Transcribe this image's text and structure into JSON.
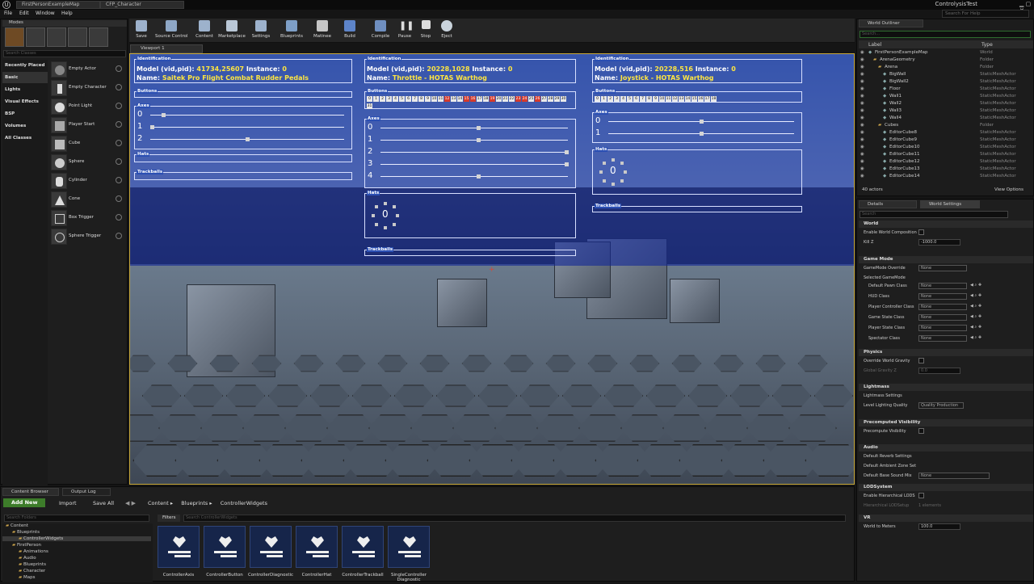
{
  "window": {
    "tabs": [
      "FirstPersonExampleMap",
      "CFP_Character"
    ],
    "project": "ControlysisTest",
    "help_placeholder": "Search For Help"
  },
  "menu": [
    "File",
    "Edit",
    "Window",
    "Help"
  ],
  "modes": {
    "title": "Modes",
    "search_placeholder": "Search Classes",
    "categories": [
      "Recently Placed",
      "Basic",
      "Lights",
      "Visual Effects",
      "BSP",
      "Volumes",
      "All Classes"
    ],
    "items": [
      "Empty Actor",
      "Empty Character",
      "Point Light",
      "Player Start",
      "Cube",
      "Sphere",
      "Cylinder",
      "Cone",
      "Box Trigger",
      "Sphere Trigger"
    ]
  },
  "toolbar": [
    "Save",
    "Source Control",
    "Content",
    "Marketplace",
    "Settings",
    "Blueprints",
    "Matinee",
    "Build",
    "Compile",
    "Pause",
    "Stop",
    "Eject"
  ],
  "viewport": {
    "tab": "Viewport 1",
    "panels": [
      {
        "model_label": "Model (vid,pid):",
        "model": "41734,25607",
        "instance_label": "Instance:",
        "instance": "0",
        "name_label": "Name:",
        "name": "Saitek Pro Flight Combat Rudder Pedals",
        "buttons": [],
        "axes": [
          {
            "label": "0",
            "value": 0.06
          },
          {
            "label": "1",
            "value": 0.0
          },
          {
            "label": "2",
            "value": 0.5
          }
        ],
        "hat": null
      },
      {
        "model_label": "Model (vid,pid):",
        "model": "20228,1028",
        "instance_label": "Instance:",
        "instance": "0",
        "name_label": "Name:",
        "name": "Throttle - HOTAS Warthog",
        "buttons": [
          "0",
          "1",
          "2",
          "3",
          "4",
          "5",
          "6",
          "7",
          "8",
          "9",
          "10",
          "11",
          "12",
          "13",
          "14",
          "15",
          "16",
          "17",
          "18",
          "19",
          "20",
          "21",
          "22",
          "23",
          "24",
          "25",
          "26",
          "27",
          "28",
          "29",
          "30",
          "31"
        ],
        "buttons_on": [
          "12",
          "15",
          "16",
          "19",
          "23",
          "24",
          "26"
        ],
        "axes": [
          {
            "label": "0",
            "value": 0.52
          },
          {
            "label": "1",
            "value": 0.52
          },
          {
            "label": "2",
            "value": 1.0
          },
          {
            "label": "3",
            "value": 1.0
          },
          {
            "label": "4",
            "value": 0.52
          }
        ],
        "hat": "0"
      },
      {
        "model_label": "Model (vid,pid):",
        "model": "20228,516",
        "instance_label": "Instance:",
        "instance": "0",
        "name_label": "Name:",
        "name": "Joystick - HOTAS Warthog",
        "buttons": [
          "0",
          "1",
          "2",
          "3",
          "4",
          "5",
          "6",
          "7",
          "8",
          "9",
          "10",
          "11",
          "12",
          "13",
          "14",
          "15",
          "16",
          "17",
          "18"
        ],
        "buttons_on": [],
        "axes": [
          {
            "label": "0",
            "value": 0.5
          },
          {
            "label": "1",
            "value": 0.5
          }
        ],
        "hat": "0"
      }
    ],
    "sections": {
      "id": "Identification",
      "buttons": "Buttons",
      "axes": "Axes",
      "hats": "Hats",
      "trackballs": "Trackballs"
    }
  },
  "outliner": {
    "title": "World Outliner",
    "search_placeholder": "Search...",
    "col_label": "Label",
    "col_type": "Type",
    "rows": [
      {
        "label": "FirstPersonExampleMap",
        "type": "World",
        "indent": 0
      },
      {
        "label": "ArenaGeometry",
        "type": "Folder",
        "indent": 1
      },
      {
        "label": "Arena",
        "type": "Folder",
        "indent": 2
      },
      {
        "label": "BigWall",
        "type": "StaticMeshActor",
        "indent": 3
      },
      {
        "label": "BigWall2",
        "type": "StaticMeshActor",
        "indent": 3
      },
      {
        "label": "Floor",
        "type": "StaticMeshActor",
        "indent": 3
      },
      {
        "label": "Wall1",
        "type": "StaticMeshActor",
        "indent": 3
      },
      {
        "label": "Wall2",
        "type": "StaticMeshActor",
        "indent": 3
      },
      {
        "label": "Wall3",
        "type": "StaticMeshActor",
        "indent": 3
      },
      {
        "label": "Wall4",
        "type": "StaticMeshActor",
        "indent": 3
      },
      {
        "label": "Cubes",
        "type": "Folder",
        "indent": 2
      },
      {
        "label": "EditorCube8",
        "type": "StaticMeshActor",
        "indent": 3
      },
      {
        "label": "EditorCube9",
        "type": "StaticMeshActor",
        "indent": 3
      },
      {
        "label": "EditorCube10",
        "type": "StaticMeshActor",
        "indent": 3
      },
      {
        "label": "EditorCube11",
        "type": "StaticMeshActor",
        "indent": 3
      },
      {
        "label": "EditorCube12",
        "type": "StaticMeshActor",
        "indent": 3
      },
      {
        "label": "EditorCube13",
        "type": "StaticMeshActor",
        "indent": 3
      },
      {
        "label": "EditorCube14",
        "type": "StaticMeshActor",
        "indent": 3
      }
    ],
    "count": "40 actors",
    "view_options": "View Options"
  },
  "details": {
    "tabs": [
      "Details",
      "World Settings"
    ],
    "search_placeholder": "Search",
    "world": {
      "hdr": "World",
      "enable_comp": "Enable World Composition",
      "killz_label": "Kill Z",
      "killz": "-1000.0"
    },
    "gamemode": {
      "hdr": "Game Mode",
      "override_label": "GameMode Override",
      "override": "None",
      "selected": "Selected GameMode",
      "classes": [
        {
          "label": "Default Pawn Class",
          "value": "None"
        },
        {
          "label": "HUD Class",
          "value": "None"
        },
        {
          "label": "Player Controller Class",
          "value": "None"
        },
        {
          "label": "Game State Class",
          "value": "None"
        },
        {
          "label": "Player State Class",
          "value": "None"
        },
        {
          "label": "Spectator Class",
          "value": "None"
        }
      ]
    },
    "physics": {
      "hdr": "Physics",
      "override": "Override World Gravity",
      "gravity_label": "Global Gravity Z",
      "gravity": "0.0"
    },
    "lightmass": {
      "hdr": "Lightmass",
      "settings": "Lightmass Settings",
      "quality_label": "Level Lighting Quality",
      "quality": "Quality Production"
    },
    "precomputed": {
      "hdr": "Precomputed Visibility",
      "label": "Precompute Visibility"
    },
    "audio": {
      "hdr": "Audio",
      "reverb": "Default Reverb Settings",
      "ambient": "Default Ambient Zone Set",
      "mix_label": "Default Base Sound Mix",
      "mix": "None"
    },
    "lod": {
      "hdr": "LODSystem",
      "enable": "Enable Hierarchical LODS",
      "setup_label": "Hierarchical LODSetup",
      "setup": "1 elements"
    },
    "vr": {
      "hdr": "VR",
      "meters_label": "World to Meters",
      "meters": "100.0"
    }
  },
  "content_browser": {
    "tabs": [
      "Content Browser",
      "Output Log"
    ],
    "add_new": "Add New",
    "import": "Import",
    "save_all": "Save All",
    "path": [
      "Content",
      "Blueprints",
      "ControllerWidgets"
    ],
    "search_folders": "Search Folders",
    "filters": "Filters",
    "search_assets": "Search ControllerWidgets",
    "tree": [
      {
        "label": "Content",
        "indent": 0
      },
      {
        "label": "Blueprints",
        "indent": 1
      },
      {
        "label": "ControllerWidgets",
        "indent": 2,
        "sel": true
      },
      {
        "label": "FirstPerson",
        "indent": 1
      },
      {
        "label": "Animations",
        "indent": 2
      },
      {
        "label": "Audio",
        "indent": 2
      },
      {
        "label": "Blueprints",
        "indent": 2
      },
      {
        "label": "Character",
        "indent": 2
      },
      {
        "label": "Maps",
        "indent": 2
      }
    ],
    "assets": [
      "ControllerAxis",
      "ControllerButton",
      "ControllerDiagnostic",
      "ControllerHat",
      "ControllerTrackball",
      "SingleController Diagnostic"
    ]
  }
}
